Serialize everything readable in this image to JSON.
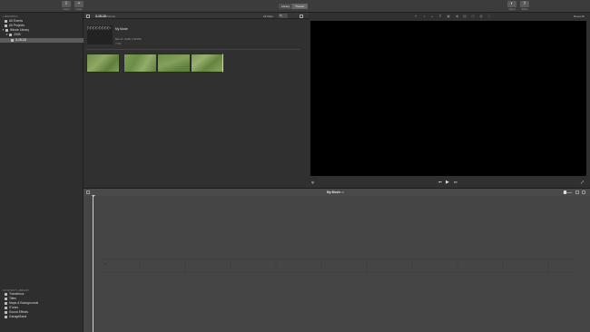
{
  "toolbar": {
    "import_label": "Import",
    "create_label": "Create",
    "tabs": [
      {
        "label": "Library",
        "active": false
      },
      {
        "label": "Theater",
        "active": true
      }
    ],
    "share_label": "Share",
    "adjust_label": "Adjust"
  },
  "sidebar": {
    "libraries_heading": "LIBRARIES",
    "items": [
      {
        "label": "All Events",
        "icon": "star-icon"
      },
      {
        "label": "All Projects",
        "icon": "film-icon"
      },
      {
        "label": "iMovie Library",
        "icon": "library-icon",
        "expanded": true
      },
      {
        "label": "2008",
        "icon": "folder-icon",
        "expanded": true
      },
      {
        "label": "3-15-18",
        "icon": "event-icon",
        "selected": true
      }
    ],
    "content_heading": "CONTENT LIBRARY",
    "content_items": [
      {
        "label": "Transitions",
        "icon": "transitions-icon"
      },
      {
        "label": "Titles",
        "icon": "titles-icon"
      },
      {
        "label": "Maps & Backgrounds",
        "icon": "map-icon"
      },
      {
        "label": "iTunes",
        "icon": "music-icon"
      },
      {
        "label": "Sound Effects",
        "icon": "speaker-icon"
      },
      {
        "label": "GarageBand",
        "icon": "guitar-icon"
      }
    ]
  },
  "browser": {
    "event_title": "3-15-18",
    "item_count": "5 Items",
    "filter_label": "All Clips",
    "filter_value": "5s",
    "project": {
      "name": "My Movie",
      "date": "Mar 17, 2018, 3:33 PM",
      "duration": "0s"
    },
    "clips": [
      {
        "color": "#6f8d4a"
      },
      {
        "color": "#7a9a55"
      },
      {
        "color": "#6a8d46"
      },
      {
        "color": "#809b57"
      }
    ]
  },
  "viewer": {
    "reset_label": "Reset All",
    "mic_icon": "microphone-icon",
    "fullscreen_icon": "fullscreen-icon"
  },
  "timeline": {
    "title": "My Movie",
    "duration": "0s"
  },
  "colors": {
    "selection_border": "#ffd22e",
    "viewer_bg": "#000000"
  }
}
